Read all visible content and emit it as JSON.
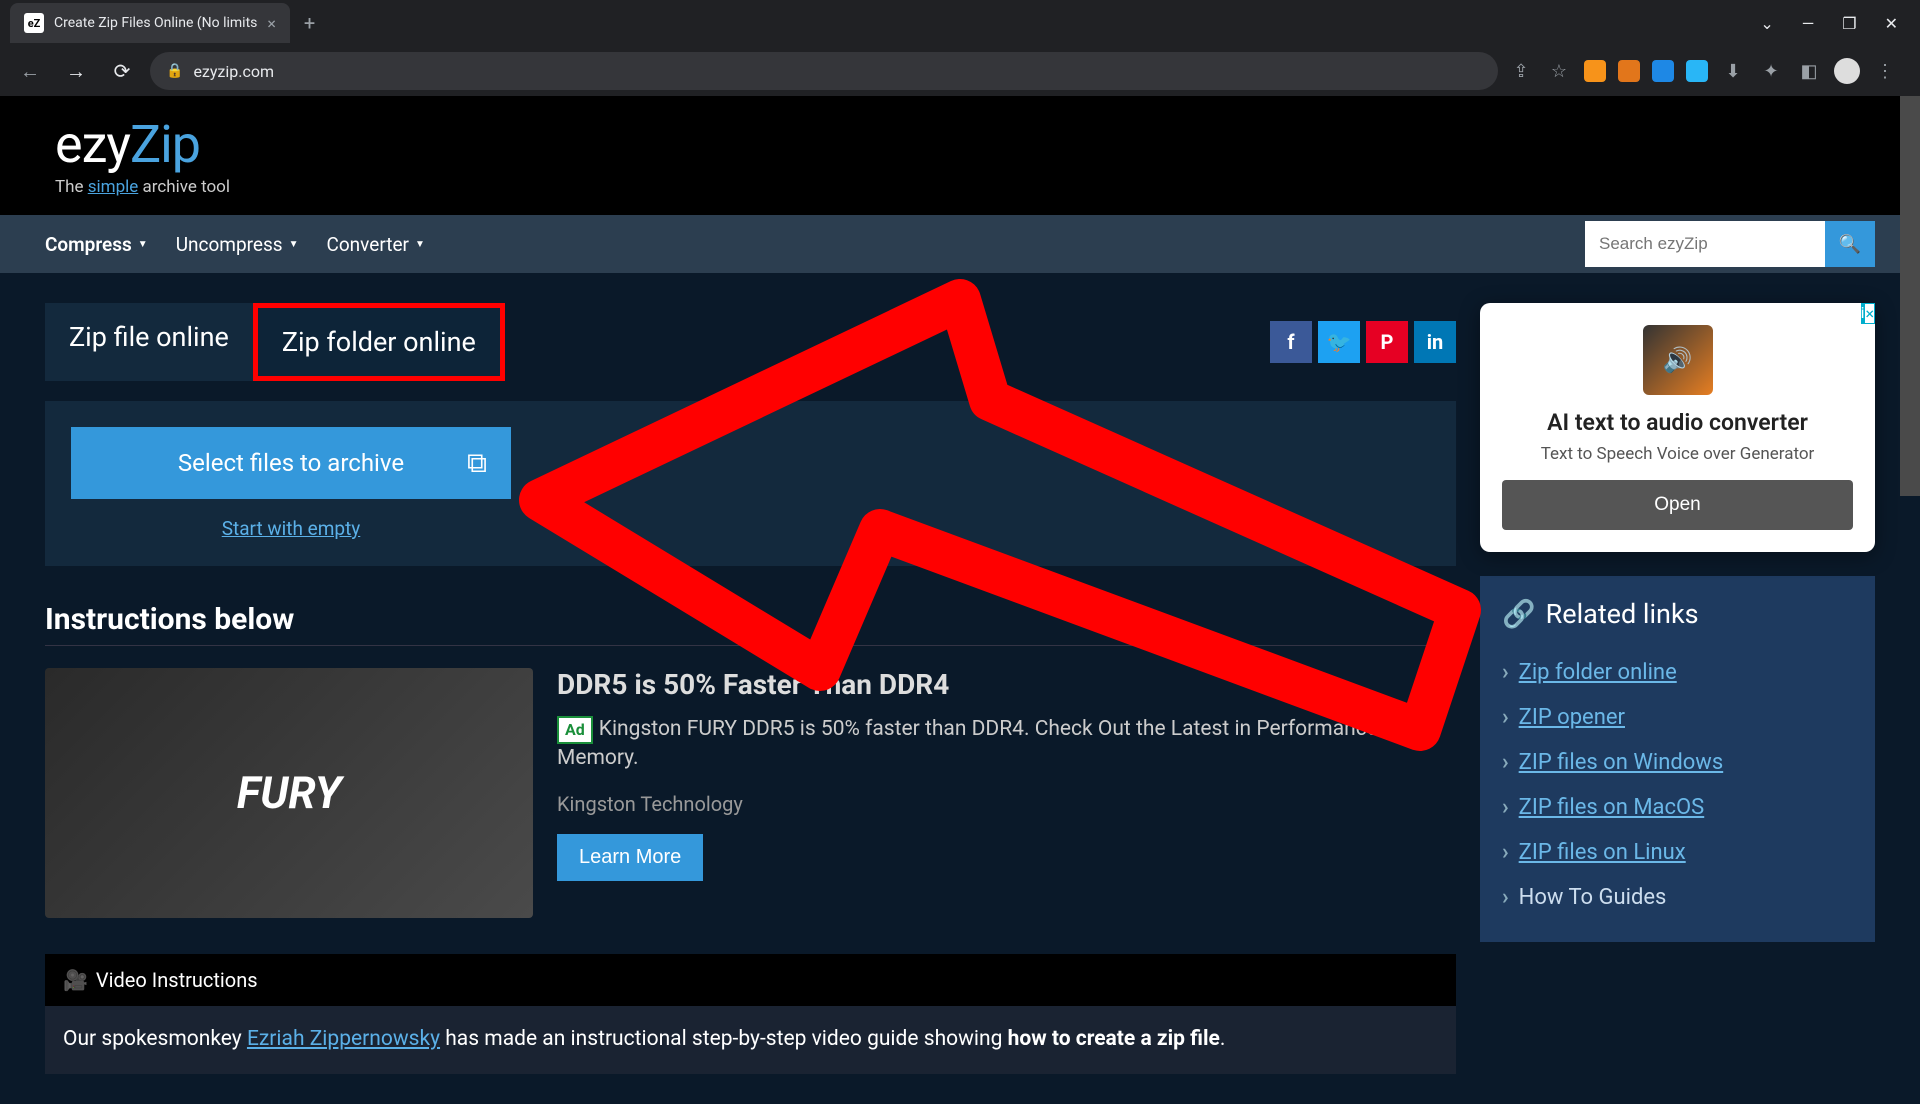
{
  "browser": {
    "tab_favicon": "eZ",
    "tab_title": "Create Zip Files Online (No limits",
    "url_display": "ezyzip.com",
    "window_restore": "❐",
    "window_minimize": "—",
    "window_close": "✕",
    "window_dropdown": "⌄",
    "new_tab": "+"
  },
  "logo": {
    "part1": "ezy",
    "part2": "Zip"
  },
  "tagline": {
    "pre": "The ",
    "simple": "simple",
    "post": " archive tool"
  },
  "nav": {
    "items": [
      {
        "label": "Compress"
      },
      {
        "label": "Uncompress"
      },
      {
        "label": "Converter"
      }
    ],
    "search_placeholder": "Search ezyZip"
  },
  "tabs": {
    "file": "Zip file online",
    "folder": "Zip folder online"
  },
  "upload": {
    "button": "Select files to archive",
    "start_empty": "Start with empty"
  },
  "socials": {
    "fb": "f",
    "tw": "🐦",
    "pin": "P",
    "li": "in"
  },
  "instructions_heading": "Instructions below",
  "inline_ad": {
    "title": "DDR5 is 50% Faster Than DDR4",
    "badge": "Ad",
    "desc": "Kingston FURY DDR5 is 50% faster than DDR4. Check Out the Latest in Performance Memory.",
    "brand": "Kingston Technology",
    "cta": "Learn More"
  },
  "video": {
    "header": "Video Instructions",
    "text_pre": "Our spokesmonkey ",
    "author": "Ezriah Zippernowsky",
    "text_mid": " has made an instructional step-by-step video guide showing ",
    "text_strong": "how to create a zip file",
    "text_post": "."
  },
  "side_ad": {
    "title": "AI text to audio converter",
    "subtitle": "Text to Speech Voice over Generator",
    "cta": "Open"
  },
  "related": {
    "title": "Related links",
    "links": [
      {
        "label": "Zip folder online",
        "link": true
      },
      {
        "label": "ZIP opener",
        "link": true
      },
      {
        "label": "ZIP files on Windows",
        "link": true
      },
      {
        "label": "ZIP files on MacOS",
        "link": true
      },
      {
        "label": "ZIP files on Linux",
        "link": true
      },
      {
        "label": "How To Guides",
        "link": false
      }
    ]
  }
}
